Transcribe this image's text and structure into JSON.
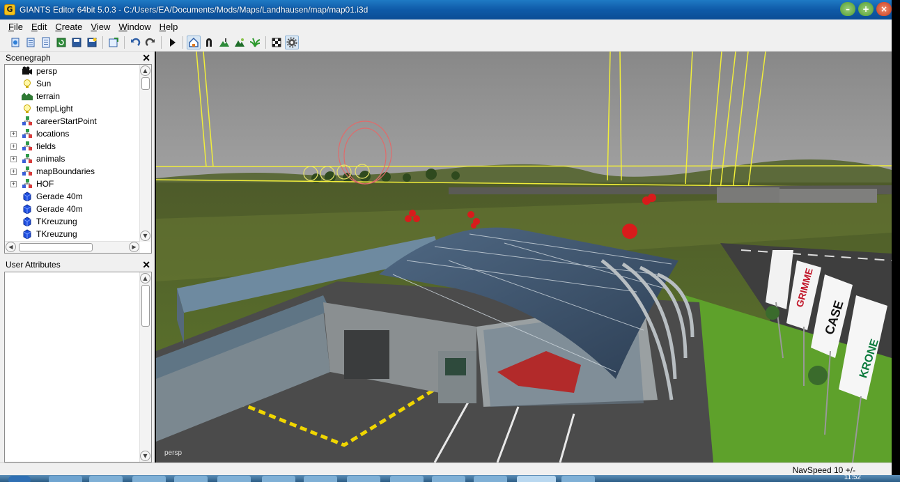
{
  "window": {
    "title": "GIANTS Editor 64bit 5.0.3 - C:/Users/EA/Documents/Mods/Maps/Landhausen/map/map01.i3d",
    "app_icon": "G"
  },
  "menu": [
    "File",
    "Edit",
    "Create",
    "View",
    "Window",
    "Help"
  ],
  "toolbar": {
    "icons": [
      "new-icon",
      "open-icon",
      "list-icon",
      "refresh-icon",
      "save-icon",
      "save-as-icon",
      "import-icon",
      "undo-icon",
      "redo-icon",
      "play-icon",
      "select-icon",
      "move-icon",
      "terrain-sculpt-icon",
      "terrain-paint-icon",
      "foliage-icon",
      "checker-icon",
      "gear-icon"
    ]
  },
  "scenegraph": {
    "title": "Scenegraph",
    "items": [
      {
        "label": "persp",
        "icon": "camera-icon",
        "expandable": false
      },
      {
        "label": "Sun",
        "icon": "light-icon",
        "expandable": false
      },
      {
        "label": "terrain",
        "icon": "terrain-icon",
        "expandable": false
      },
      {
        "label": "tempLight",
        "icon": "light-icon",
        "expandable": false
      },
      {
        "label": "careerStartPoint",
        "icon": "transform-group-icon",
        "expandable": false
      },
      {
        "label": "locations",
        "icon": "transform-group-icon",
        "expandable": true
      },
      {
        "label": "fields",
        "icon": "transform-group-icon",
        "expandable": true
      },
      {
        "label": "animals",
        "icon": "transform-group-icon",
        "expandable": true
      },
      {
        "label": "mapBoundaries",
        "icon": "transform-group-icon",
        "expandable": true
      },
      {
        "label": "HOF",
        "icon": "transform-group-icon",
        "expandable": true
      },
      {
        "label": "Gerade 40m",
        "icon": "shape-icon",
        "expandable": false
      },
      {
        "label": "Gerade 40m",
        "icon": "shape-icon",
        "expandable": false
      },
      {
        "label": "TKreuzung",
        "icon": "shape-icon",
        "expandable": false
      },
      {
        "label": "TKreuzung",
        "icon": "shape-icon",
        "expandable": false
      }
    ]
  },
  "user_attributes": {
    "title": "User Attributes"
  },
  "viewport": {
    "camera_label": "persp"
  },
  "status": {
    "nav_speed": "NavSpeed 10 +/-",
    "clock": "11:52"
  }
}
